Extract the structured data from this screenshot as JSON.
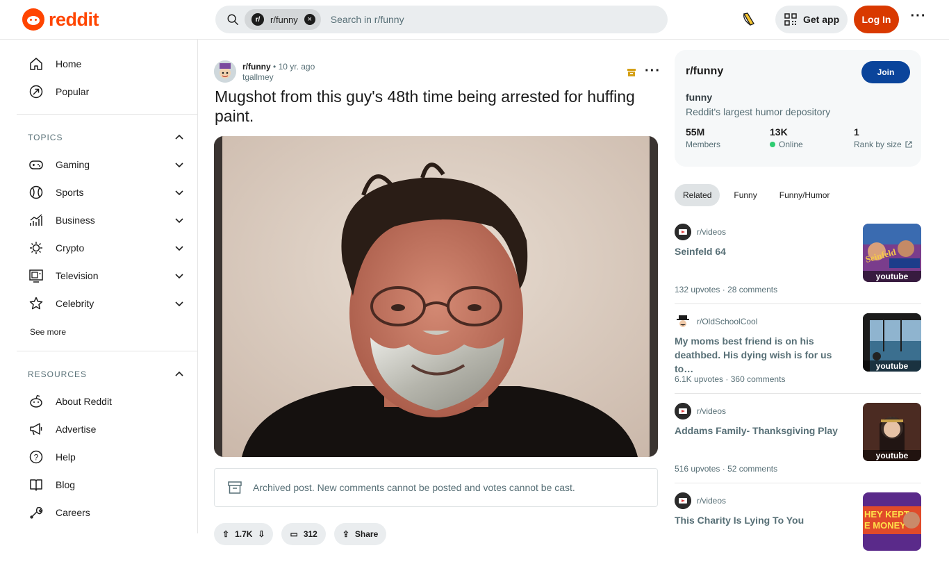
{
  "header": {
    "logo_text": "reddit",
    "search_chip": "r/funny",
    "search_placeholder": "Search in r/funny",
    "get_app": "Get app",
    "login": "Log In"
  },
  "sidebar": {
    "nav": [
      {
        "label": "Home",
        "icon": "home-icon"
      },
      {
        "label": "Popular",
        "icon": "popular-icon"
      }
    ],
    "topics_title": "TOPICS",
    "topics": [
      {
        "label": "Gaming",
        "icon": "gamepad-icon"
      },
      {
        "label": "Sports",
        "icon": "ball-icon"
      },
      {
        "label": "Business",
        "icon": "chart-icon"
      },
      {
        "label": "Crypto",
        "icon": "crypto-icon"
      },
      {
        "label": "Television",
        "icon": "tv-icon"
      },
      {
        "label": "Celebrity",
        "icon": "star-icon"
      }
    ],
    "see_more": "See more",
    "resources_title": "RESOURCES",
    "resources": [
      {
        "label": "About Reddit",
        "icon": "reddit-alien-icon"
      },
      {
        "label": "Advertise",
        "icon": "megaphone-icon"
      },
      {
        "label": "Help",
        "icon": "help-icon"
      },
      {
        "label": "Blog",
        "icon": "book-icon"
      },
      {
        "label": "Careers",
        "icon": "wrench-icon"
      }
    ]
  },
  "post": {
    "subreddit": "r/funny",
    "separator": "•",
    "time": "10 yr. ago",
    "user": "tgallmey",
    "title": "Mugshot from this guy's 48th time being arrested for huffing paint.",
    "archived_text": "Archived post. New comments cannot be posted and votes cannot be cast.",
    "actions": {
      "votes": "1.7K",
      "comments": "312",
      "share": "Share"
    }
  },
  "community": {
    "title": "r/funny",
    "join": "Join",
    "name": "funny",
    "description": "Reddit's largest humor depository",
    "stats": [
      {
        "value": "55M",
        "label": "Members"
      },
      {
        "value": "13K",
        "label": "Online"
      },
      {
        "value": "1",
        "label": "Rank by size"
      }
    ]
  },
  "tabs": [
    "Related",
    "Funny",
    "Funny/Humor"
  ],
  "related": [
    {
      "sub": "r/videos",
      "title": "Seinfeld 64",
      "upvotes": "132 upvotes",
      "comments": "28 comments",
      "thumb_label": "youtube"
    },
    {
      "sub": "r/OldSchoolCool",
      "title": "My moms best friend is on his deathbed. His dying wish is for us to…",
      "upvotes": "6.1K upvotes",
      "comments": "360 comments",
      "thumb_label": "youtube"
    },
    {
      "sub": "r/videos",
      "title": "Addams Family- Thanksgiving Play",
      "upvotes": "516 upvotes",
      "comments": "52 comments",
      "thumb_label": "youtube"
    },
    {
      "sub": "r/videos",
      "title": "This Charity Is Lying To You",
      "upvotes": "",
      "comments": "",
      "thumb_label": ""
    }
  ],
  "colors": {
    "brand": "#ff4500",
    "login": "#d93900",
    "join": "#0a449b",
    "online": "#2ecc71"
  }
}
